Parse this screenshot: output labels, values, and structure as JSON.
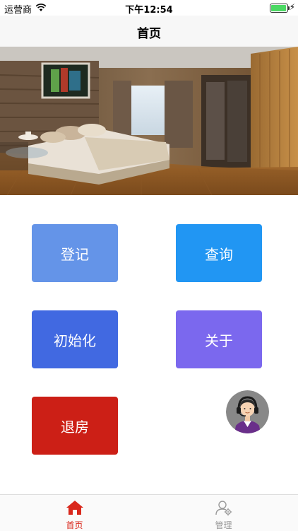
{
  "status": {
    "carrier": "运营商",
    "time": "下午12:54",
    "battery_level": 0.95
  },
  "nav": {
    "title": "首页"
  },
  "buttons": {
    "register": "登记",
    "query": "查询",
    "initialize": "初始化",
    "about": "关于",
    "checkout": "退房"
  },
  "colors": {
    "register": "#6494e8",
    "query": "#2196f3",
    "initialize": "#4169e1",
    "about": "#7b68ee",
    "checkout": "#cc1f16",
    "tab_active": "#d9281c",
    "tab_inactive": "#999999"
  },
  "tabs": [
    {
      "label": "首页",
      "icon": "home-icon",
      "active": true
    },
    {
      "label": "管理",
      "icon": "user-settings-icon",
      "active": false
    }
  ],
  "banner": {
    "icon": "hotel-room-photo"
  },
  "support": {
    "icon": "customer-service-avatar"
  }
}
